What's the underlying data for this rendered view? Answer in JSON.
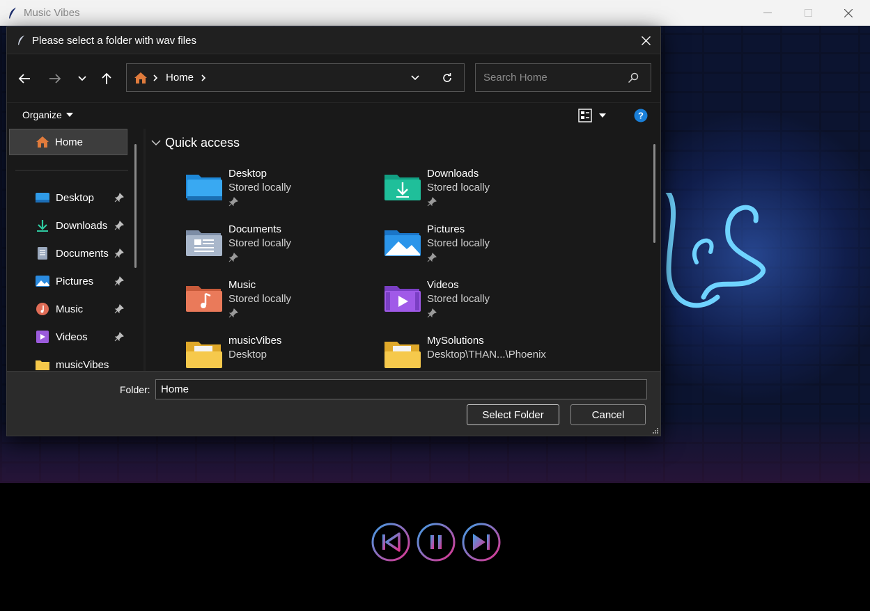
{
  "app": {
    "title": "Music Vibes"
  },
  "dialog": {
    "title": "Please select a folder with wav files",
    "address": {
      "crumbs": [
        "Home"
      ]
    },
    "search": {
      "placeholder": "Search Home"
    },
    "organize_label": "Organize",
    "sidebar": {
      "home_label": "Home",
      "items": [
        {
          "label": "Desktop",
          "icon": "desktop-icon",
          "pinned": true
        },
        {
          "label": "Downloads",
          "icon": "downloads-icon",
          "pinned": true
        },
        {
          "label": "Documents",
          "icon": "documents-icon",
          "pinned": true
        },
        {
          "label": "Pictures",
          "icon": "pictures-icon",
          "pinned": true
        },
        {
          "label": "Music",
          "icon": "music-icon",
          "pinned": true
        },
        {
          "label": "Videos",
          "icon": "videos-icon",
          "pinned": true
        },
        {
          "label": "musicVibes",
          "icon": "folder-icon",
          "pinned": false
        }
      ]
    },
    "quick_access": {
      "heading": "Quick access",
      "tiles": [
        {
          "name": "Desktop",
          "sub": "Stored locally",
          "icon": "desktop-folder-icon",
          "pinned": true
        },
        {
          "name": "Downloads",
          "sub": "Stored locally",
          "icon": "downloads-folder-icon",
          "pinned": true
        },
        {
          "name": "Documents",
          "sub": "Stored locally",
          "icon": "documents-folder-icon",
          "pinned": true
        },
        {
          "name": "Pictures",
          "sub": "Stored locally",
          "icon": "pictures-folder-icon",
          "pinned": true
        },
        {
          "name": "Music",
          "sub": "Stored locally",
          "icon": "music-folder-icon",
          "pinned": true
        },
        {
          "name": "Videos",
          "sub": "Stored locally",
          "icon": "videos-folder-icon",
          "pinned": true
        },
        {
          "name": "musicVibes",
          "sub": "Desktop",
          "icon": "folder-icon",
          "pinned": false
        },
        {
          "name": "MySolutions",
          "sub": "Desktop\\THAN...\\Phoenix",
          "icon": "folder-icon",
          "pinned": false
        }
      ]
    },
    "footer": {
      "folder_label": "Folder:",
      "folder_value": "Home",
      "select_label": "Select Folder",
      "cancel_label": "Cancel"
    }
  },
  "player": {
    "buttons": [
      "previous",
      "pause",
      "next"
    ],
    "accent_pink": "#e0338f",
    "accent_blue": "#3fa0e6"
  }
}
